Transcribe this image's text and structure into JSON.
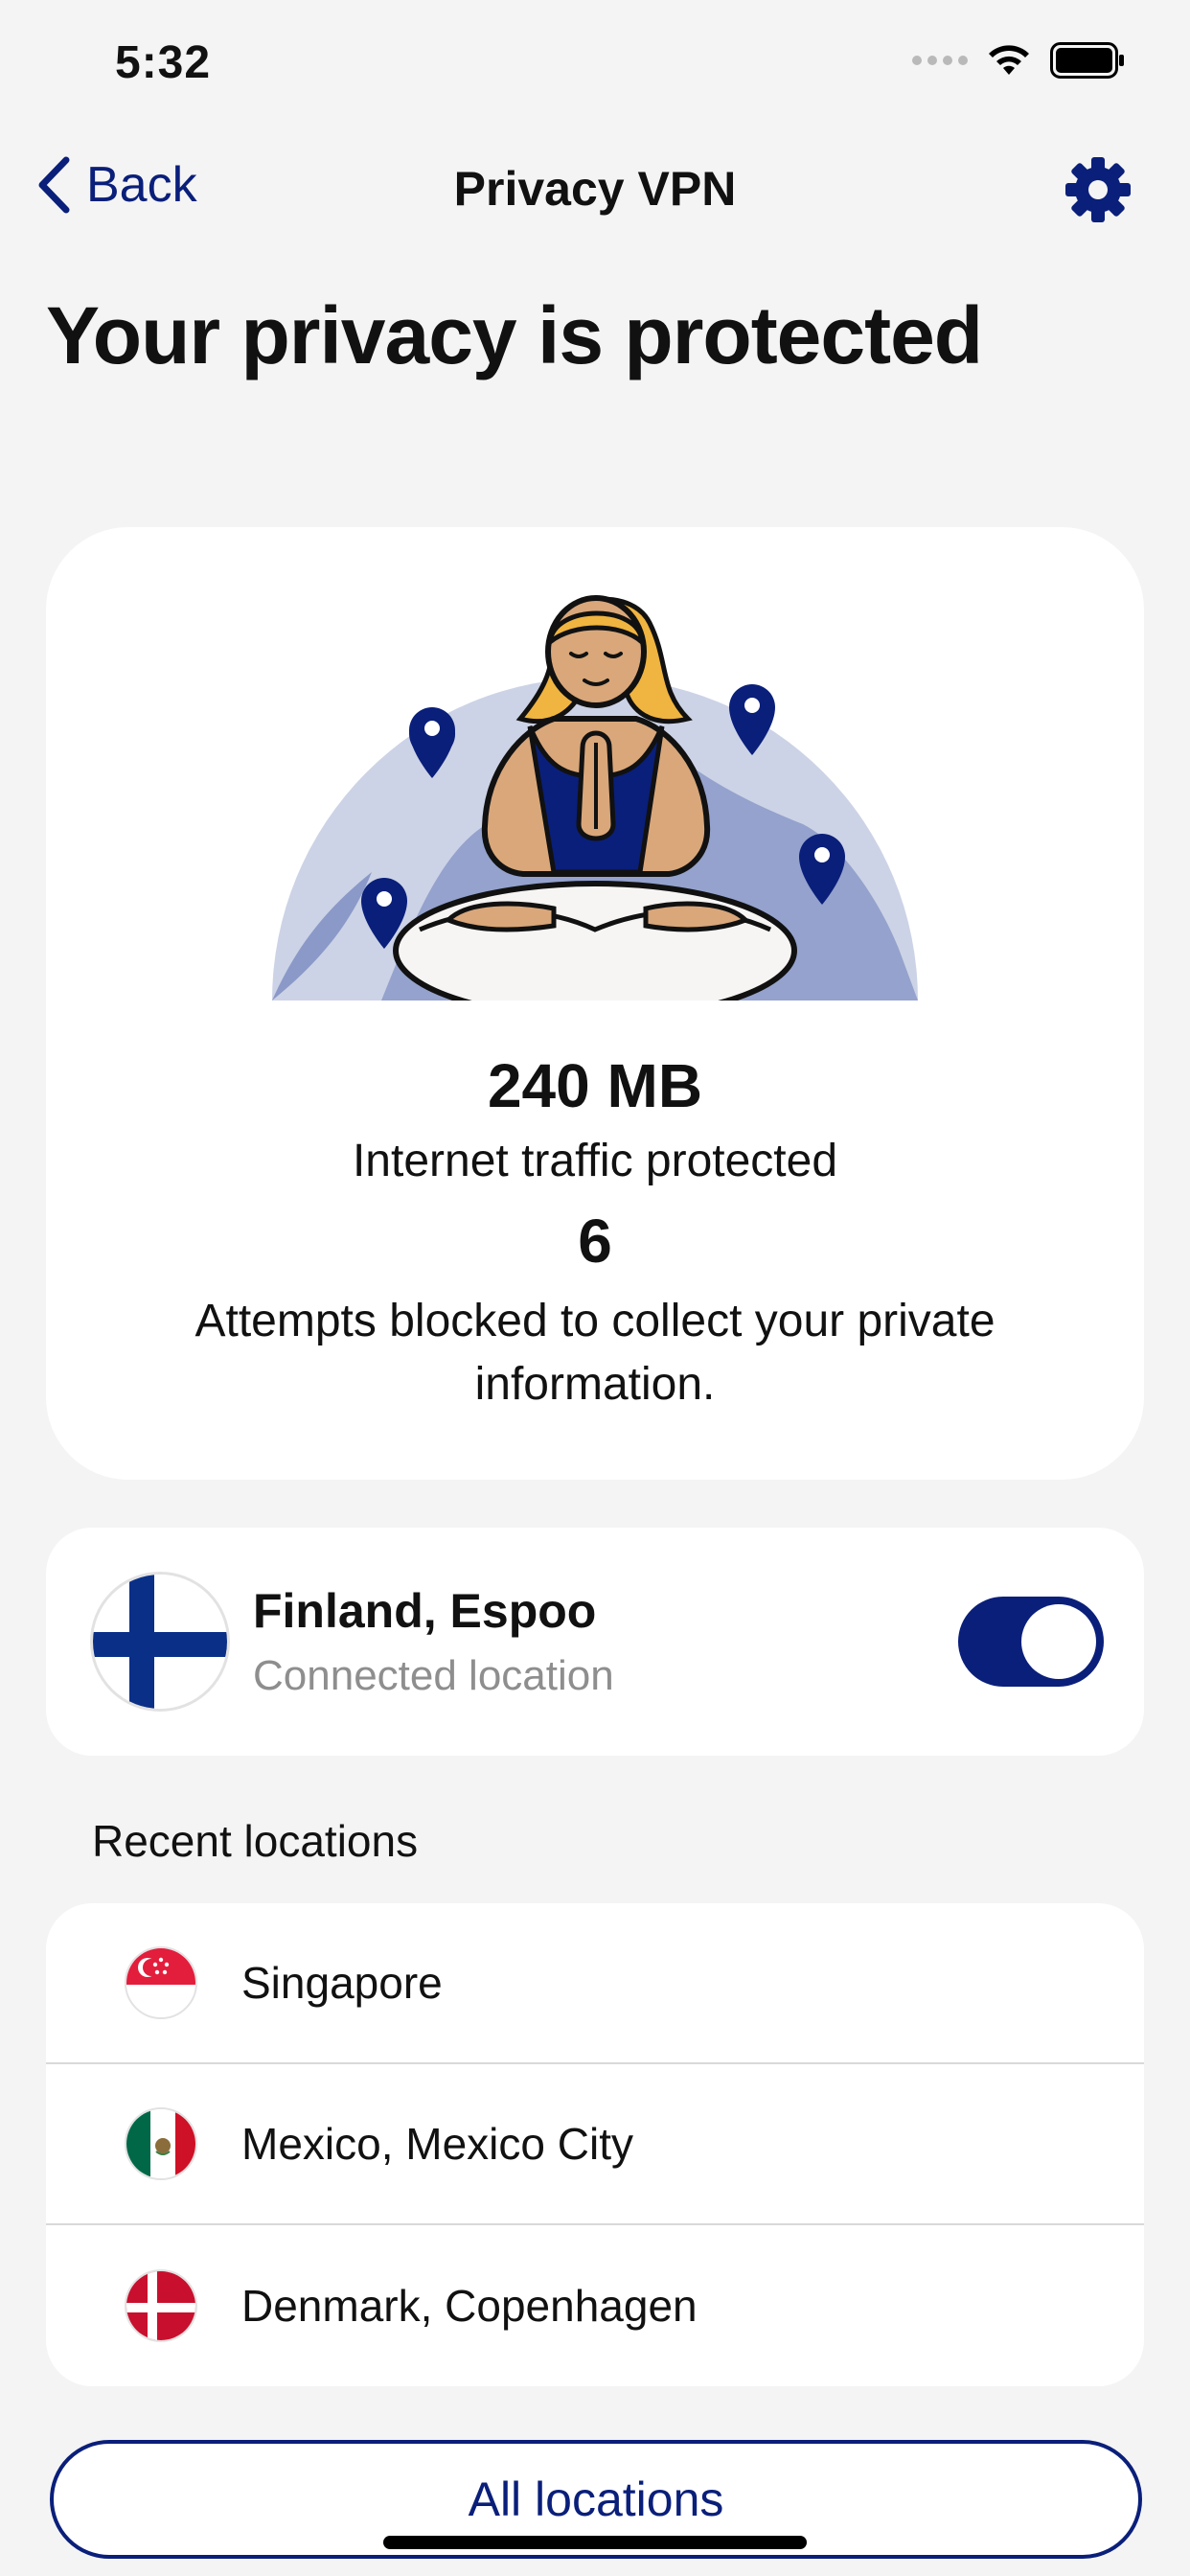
{
  "status_bar": {
    "time": "5:32"
  },
  "nav": {
    "back_label": "Back",
    "title": "Privacy VPN"
  },
  "page_title": "Your privacy is protected",
  "stats": {
    "traffic_value": "240 MB",
    "traffic_label": "Internet traffic protected",
    "attempts_value": "6",
    "attempts_label": "Attempts blocked to collect your private information."
  },
  "connected": {
    "name": "Finland, Espoo",
    "subtitle": "Connected location",
    "flag": "flag-finland",
    "enabled": true
  },
  "recent": {
    "label": "Recent locations",
    "items": [
      {
        "label": "Singapore",
        "flag": "flag-singapore"
      },
      {
        "label": "Mexico, Mexico City",
        "flag": "flag-mexico"
      },
      {
        "label": "Denmark, Copenhagen",
        "flag": "flag-denmark"
      }
    ]
  },
  "all_locations_label": "All locations",
  "colors": {
    "accent": "#0a1f7a",
    "background": "#f4f4f4",
    "card": "#ffffff",
    "muted": "#8e8e8e"
  }
}
